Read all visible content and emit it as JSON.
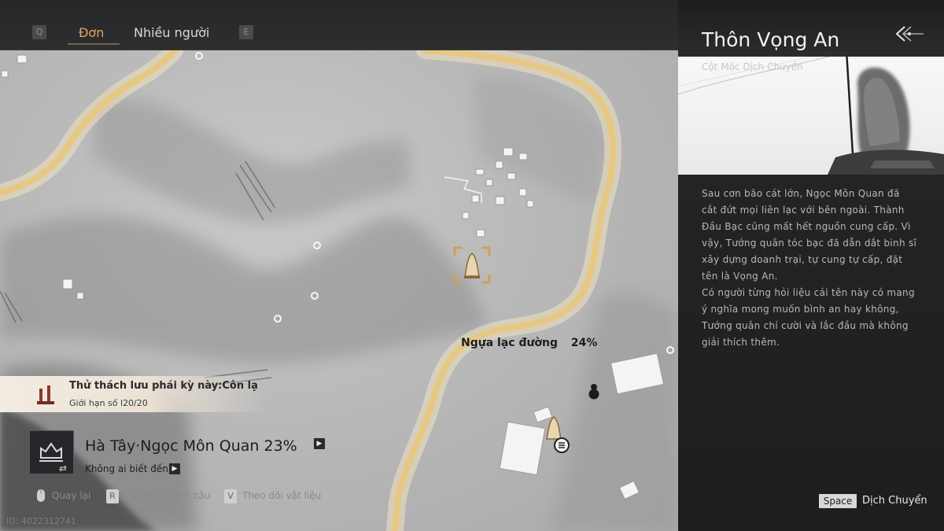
{
  "tabs": {
    "prev_key": "Q",
    "next_key": "E",
    "items": [
      {
        "label": "Đơn",
        "active": true
      },
      {
        "label": "Nhiều người",
        "active": false
      }
    ]
  },
  "map": {
    "poi_label": "Ngựa lạc đường",
    "poi_progress": "24%"
  },
  "challenge": {
    "title": "Thử thách lưu phái kỳ này:Côn lạ",
    "limit_label": "Giới hạn số l",
    "limit_value": "20/20"
  },
  "region": {
    "name": "Hà Tây·Ngọc Môn Quan 23%",
    "sub": "Không ai biết đến"
  },
  "hints": [
    {
      "key": "",
      "label": "Quay lại"
    },
    {
      "key": "R",
      "label": "Lọc dấu chấm câu"
    },
    {
      "key": "V",
      "label": "Theo dõi vật liệu"
    }
  ],
  "player_id": "ID: 4022312741",
  "panel": {
    "title": "Thôn Vọng An",
    "subtitle": "Cột Mốc Dịch Chuyển",
    "description": [
      "Sau cơn bão cát lớn, Ngọc Môn Quan đã cắt đứt mọi liên lạc với bên ngoài. Thành Đầu Bạc cũng mất hết nguồn cung cấp. Vì vậy, Tướng quân tóc bạc đã dẫn dắt binh sĩ xây dựng doanh trại, tự cung tự cấp, đặt tên là Vọng An.",
      "Có người từng hỏi liệu cái tên này có mang ý nghĩa mong muốn bình an hay không, Tướng quân chỉ cười và lắc đầu mà không giải thích thêm."
    ],
    "action_key": "Space",
    "action_label": "Dịch Chuyển"
  },
  "colors": {
    "accent_tab": "#e3a45a",
    "road": "#e8c986",
    "panel_bg": "#232323"
  },
  "icons": [
    "key-q-icon",
    "key-e-icon",
    "waypoint-icon",
    "waypoint-selected-icon",
    "gourd-icon",
    "region-emblem-icon",
    "challenge-icon",
    "mouse-icon",
    "back-arrow-icon"
  ]
}
